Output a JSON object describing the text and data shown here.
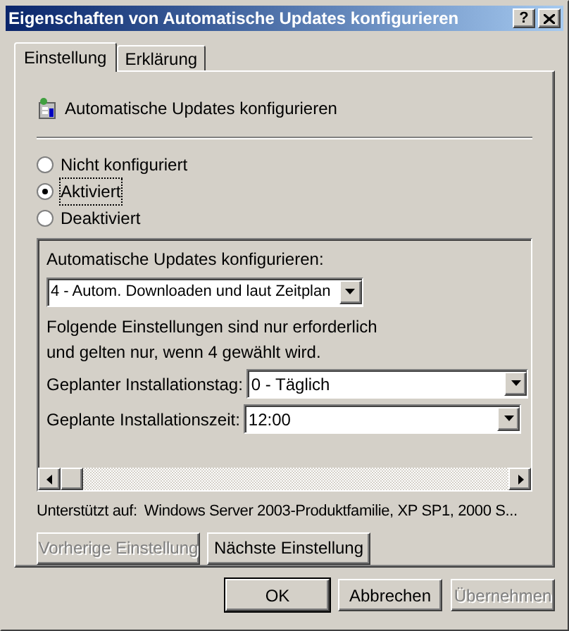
{
  "window": {
    "title": "Eigenschaften von Automatische Updates konfigurieren",
    "help_button": "?"
  },
  "tabs": [
    {
      "label": "Einstellung",
      "selected": true
    },
    {
      "label": "Erklärung",
      "selected": false
    }
  ],
  "policy": {
    "title": "Automatische Updates konfigurieren"
  },
  "options": [
    {
      "label": "Nicht konfiguriert",
      "selected": false
    },
    {
      "label": "Aktiviert",
      "selected": true
    },
    {
      "label": "Deaktiviert",
      "selected": false
    }
  ],
  "settings": {
    "mode_label": "Automatische Updates konfigurieren:",
    "mode_value": "4 - Autom. Downloaden und laut Zeitplan",
    "note_lines": [
      "Folgende Einstellungen sind nur erforderlich",
      "und gelten nur, wenn 4 gewählt wird."
    ],
    "fields": [
      {
        "label": "Geplanter Installationstag:",
        "value": "0 - Täglich"
      },
      {
        "label": "Geplante Installationszeit:",
        "value": "12:00"
      }
    ]
  },
  "supported": {
    "label": "Unterstützt auf:",
    "value": "Windows Server 2003-Produktfamilie, XP SP1, 2000 S..."
  },
  "nav_buttons": [
    {
      "label": "Vorherige Einstellung",
      "disabled": true
    },
    {
      "label": "Nächste Einstellung",
      "disabled": false
    }
  ],
  "buttons": [
    {
      "label": "OK",
      "disabled": false,
      "default": true
    },
    {
      "label": "Abbrechen",
      "disabled": false,
      "default": false
    },
    {
      "label": "Übernehmen",
      "disabled": true,
      "default": false
    }
  ]
}
